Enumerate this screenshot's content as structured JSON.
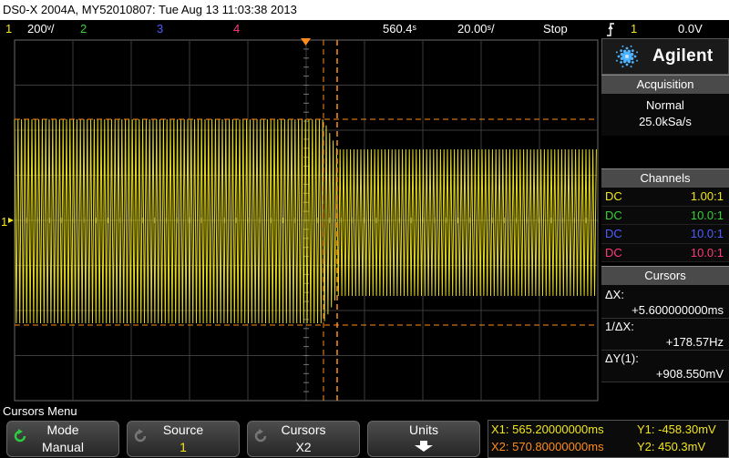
{
  "title_bar": {
    "text": "DS0-X 2004A, MY52010807: Tue Aug 13 11:03:38 2013"
  },
  "status_bar": {
    "ch1_num": "1",
    "ch1_scale": "200ᵛ/",
    "ch2_num": "2",
    "ch3_num": "3",
    "ch4_num": "4",
    "time_delay": "560.4ˢ",
    "time_scale": "20.00ˢ/",
    "run_state": "Stop",
    "trigger_icon": "trigger-edge-icon",
    "trigger_source": "1",
    "trigger_level": "0.0V"
  },
  "colors": {
    "ch1": "#f2e61d",
    "ch2": "#35d135",
    "ch3": "#4f5dff",
    "ch4": "#ff3c78",
    "cursor_x2": "#ff8c1a"
  },
  "panel": {
    "brand": "Agilent",
    "acquisition": {
      "header": "Acquisition",
      "mode": "Normal",
      "rate": "25.0kSa/s"
    },
    "channels": {
      "header": "Channels",
      "rows": [
        {
          "coupling": "DC",
          "probe": "1.00:1"
        },
        {
          "coupling": "DC",
          "probe": "10.0:1"
        },
        {
          "coupling": "DC",
          "probe": "10.0:1"
        },
        {
          "coupling": "DC",
          "probe": "10.0:1"
        }
      ]
    },
    "cursors": {
      "header": "Cursors",
      "dx_label": "ΔX:",
      "dx_value": "+5.600000000ms",
      "inv_dx_label": "1/ΔX:",
      "inv_dx_value": "+178.57Hz",
      "dy_label": "ΔY(1):",
      "dy_value": "+908.550mV"
    }
  },
  "screen": {
    "ch1_marker": "1"
  },
  "menu": {
    "title": "Cursors Menu",
    "softkeys": [
      {
        "label": "Mode",
        "value": "Manual"
      },
      {
        "label": "Source",
        "value": "1"
      },
      {
        "label": "Cursors",
        "value": "X2"
      },
      {
        "label": "Units",
        "value": ""
      }
    ]
  },
  "readout": {
    "x1": "X1: 565.20000000ms",
    "x2": "X2: 570.80000000ms",
    "y1": "Y1: -458.30mV",
    "y2": "Y2: 450.3mV"
  }
}
